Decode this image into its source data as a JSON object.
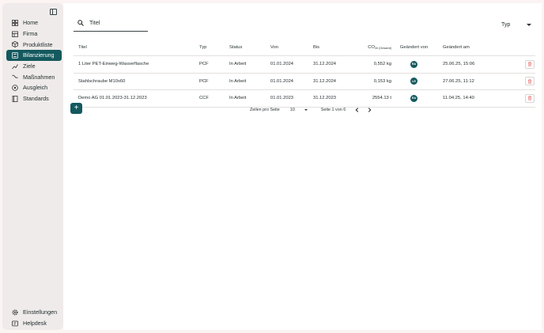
{
  "sidebar": {
    "items": [
      {
        "label": "Home",
        "icon": "grid-icon",
        "active": false
      },
      {
        "label": "Firma",
        "icon": "building-icon",
        "active": false
      },
      {
        "label": "Produktliste",
        "icon": "box-icon",
        "active": false
      },
      {
        "label": "Bilanzierung",
        "icon": "calculator-icon",
        "active": true
      },
      {
        "label": "Ziele",
        "icon": "trend-icon",
        "active": false
      },
      {
        "label": "Maßnahmen",
        "icon": "wave-icon",
        "active": false
      },
      {
        "label": "Ausgleich",
        "icon": "compass-icon",
        "active": false
      },
      {
        "label": "Standards",
        "icon": "book-icon",
        "active": false
      }
    ],
    "bottom": [
      {
        "label": "Einstellungen",
        "icon": "gear-icon"
      },
      {
        "label": "Helpdesk",
        "icon": "help-icon"
      }
    ]
  },
  "search": {
    "value": "Titel"
  },
  "filter": {
    "type_label": "Typ"
  },
  "table": {
    "headers": {
      "title": "Titel",
      "type": "Typ",
      "status": "Status",
      "from": "Von",
      "to": "Bis",
      "co2_prefix": "CO",
      "co2_sub": "2e (Gesamt)",
      "changed_by": "Geändert von",
      "changed_at": "Geändert am"
    },
    "rows": [
      {
        "title": "1 Liter PET-Einweg-Wasserflasche",
        "type": "PCF",
        "status": "In Arbeit",
        "from": "01.01.2024",
        "to": "31.12.2024",
        "co2": "0,552 kg",
        "avatar": "RA",
        "changed_at": "25.06.25, 15:06"
      },
      {
        "title": "Stahlschraube M10x60",
        "type": "PCF",
        "status": "In Arbeit",
        "from": "01.01.2024",
        "to": "31.12.2024",
        "co2": "0,153 kg",
        "avatar": "LR",
        "changed_at": "27.06.25, 11:12"
      },
      {
        "title": "Demo AG 01.01.2023-31.12.2023",
        "type": "CCF",
        "status": "In Arbeit",
        "from": "01.01.2023",
        "to": "31.12.2023",
        "co2": "2554.13 t",
        "avatar": "RA",
        "changed_at": "11.04.25, 14:40"
      }
    ]
  },
  "add_button": {
    "label": "+"
  },
  "pagination": {
    "rows_per_page_label": "Zeilen pro Seite",
    "rows_per_page": "10",
    "page_info": "Seite 1 von 6"
  },
  "colors": {
    "accent": "#14595e",
    "background": "#fbf4f3",
    "sidebar": "#efebea",
    "delete": "#e05a5a"
  }
}
